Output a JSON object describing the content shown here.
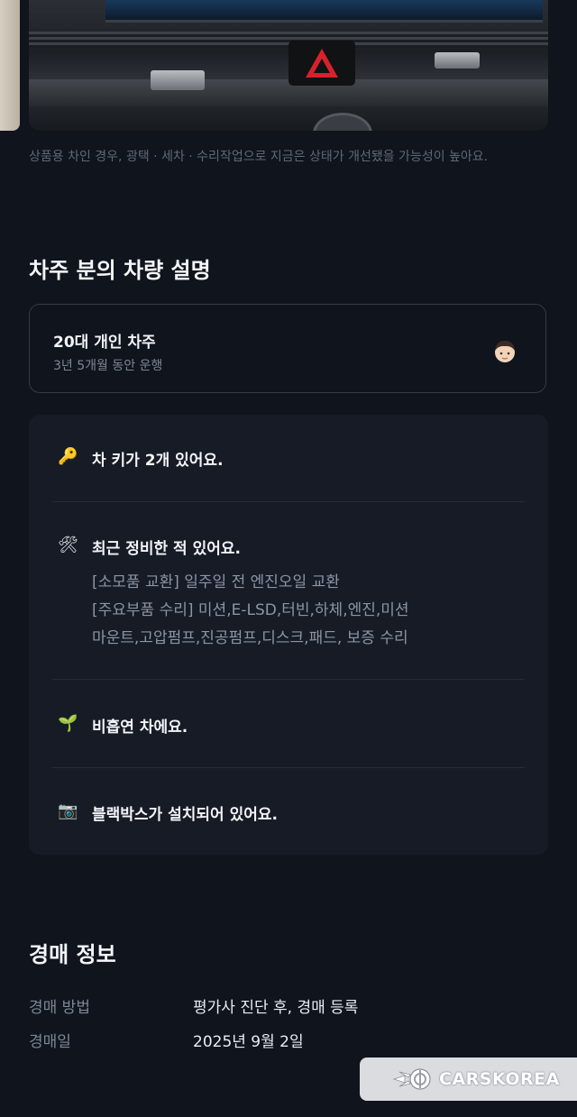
{
  "photo": {
    "caption": "상품용 차인 경우, 광택 · 세차 · 수리작업으로 지금은 상태가 개선됐을 가능성이 높아요."
  },
  "owner_section": {
    "title": "차주 분의 차량 설명",
    "owner": {
      "title": "20대 개인 차주",
      "subtitle": "3년 5개월 동안 운행",
      "avatar_icon": "boy-face-icon"
    },
    "items": [
      {
        "icon": "key-icon",
        "emoji": "🔑",
        "text": "차 키가 2개 있어요."
      },
      {
        "icon": "hammer-wrench-icon",
        "emoji": "🛠",
        "text": "최근 정비한 적 있어요.",
        "details": [
          "[소모품 교환] 일주일 전 엔진오일 교환",
          "[주요부품 수리] 미션,E-LSD,터빈,하체,엔진,미션",
          "마운트,고압펌프,진공펌프,디스크,패드, 보증 수리"
        ]
      },
      {
        "icon": "seedling-icon",
        "emoji": "🌱",
        "text": "비흡연 차에요."
      },
      {
        "icon": "camera-icon",
        "emoji": "📷",
        "text": "블랙박스가 설치되어 있어요."
      }
    ]
  },
  "auction_section": {
    "title": "경매 정보",
    "rows": [
      {
        "label": "경매 방법",
        "value": "평가사 진단 후, 경매 등록"
      },
      {
        "label": "경매일",
        "value": "2025년 9월 2일"
      }
    ]
  },
  "watermark": {
    "text": "CARSKOREA"
  },
  "colors": {
    "background": "#0f141d",
    "card_border": "#343b47",
    "box_bg": "#161b26",
    "hazard_red": "#d6222c"
  }
}
